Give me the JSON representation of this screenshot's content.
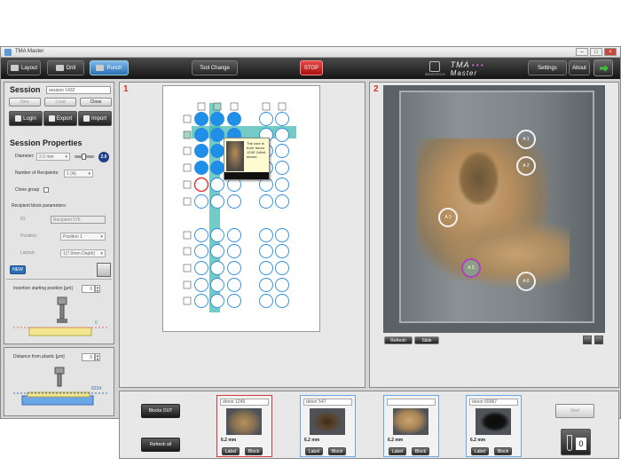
{
  "window": {
    "title": "TMA Master"
  },
  "toolbar": {
    "layout": "Layout",
    "drill": "Drill",
    "punch": "Punch",
    "tool_change": "Tool Change",
    "stop": "STOP",
    "settings": "Settings",
    "about": "About",
    "logo_sub": "3DHISTECH",
    "logo_name": "TMA",
    "logo_name2": "Master"
  },
  "session": {
    "title": "Session",
    "name": "session 1432",
    "new": "New",
    "load": "Load",
    "close": "Close",
    "login": "Login",
    "export": "Export",
    "import": "Import"
  },
  "props": {
    "title": "Session Properties",
    "diameter_label": "Diameter:",
    "diameter_value": "2.0 mm",
    "diameter_badge": "2.0",
    "recipients_label": "Number of Recipients:",
    "recipients_value": "1 (A)",
    "clone_label": "Clone group",
    "block_params": "Recipient block parameters:",
    "id_label": "ID:",
    "id_value": "Recipient 576",
    "position_label": "Position:",
    "position_value": "Position 1",
    "layout_label": "Layout:",
    "layout_value": "1(7.0mm Depth)",
    "insertion_label": "Insertion starting position [µm]",
    "insertion_value": "0",
    "dist_label": "Distance from plastic [µm]",
    "dist_value": "0",
    "dist_marker": "6234",
    "zero": "0"
  },
  "panel1": {
    "num": "1",
    "tooltip": "The core is from 'donor 1245' 2x5x6 blocks"
  },
  "panel2": {
    "num": "2",
    "refresh": "Refresh",
    "slide": "Slide",
    "markers": [
      "A 1",
      "A 2",
      "A 3",
      "A 5",
      "A 6"
    ]
  },
  "donors": [
    {
      "name": "donor 1245",
      "mm": "6.2 mm",
      "label": "Label",
      "block": "Block"
    },
    {
      "name": "donor 547",
      "mm": "6.2 mm",
      "label": "Label",
      "block": "Block"
    },
    {
      "name": "",
      "mm": "6.2 mm",
      "label": "Label",
      "block": "Block"
    },
    {
      "name": "donor 65967",
      "mm": "6.2 mm",
      "label": "Label",
      "block": "Block"
    }
  ],
  "bottom": {
    "blocks_out": "Blocks OUT",
    "refresh_all": "Refresh all",
    "start": "Start",
    "counter": "0"
  },
  "colors": {
    "filled": "#1f8fe8",
    "empty_stroke": "#2a8ae0",
    "highlight": "#46b8b0",
    "error": "#e03030",
    "accent": "#2a6fb4"
  }
}
